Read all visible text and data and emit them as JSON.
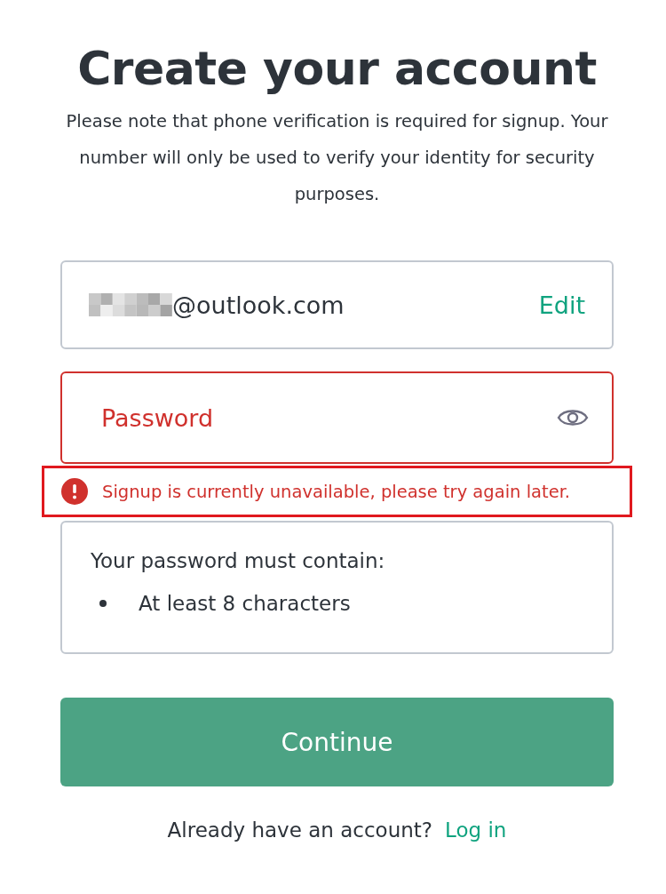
{
  "title": "Create your account",
  "description": "Please note that phone verification is required for signup. Your number will only be used to verify your identity for security purposes.",
  "email_field": {
    "value": "@outlook.com",
    "edit_link": "Edit"
  },
  "password_field": {
    "placeholder": "Password",
    "error": true
  },
  "error_message": {
    "text": "Signup is currently unavailable, please try again later.",
    "highlighted": true
  },
  "requirements": {
    "heading": "Your password must contain:",
    "items": [
      {
        "text": "At least 8 characters"
      }
    ]
  },
  "continue_button": "Continue",
  "footer": {
    "text": "Already have an account?",
    "link": "Log in"
  }
}
